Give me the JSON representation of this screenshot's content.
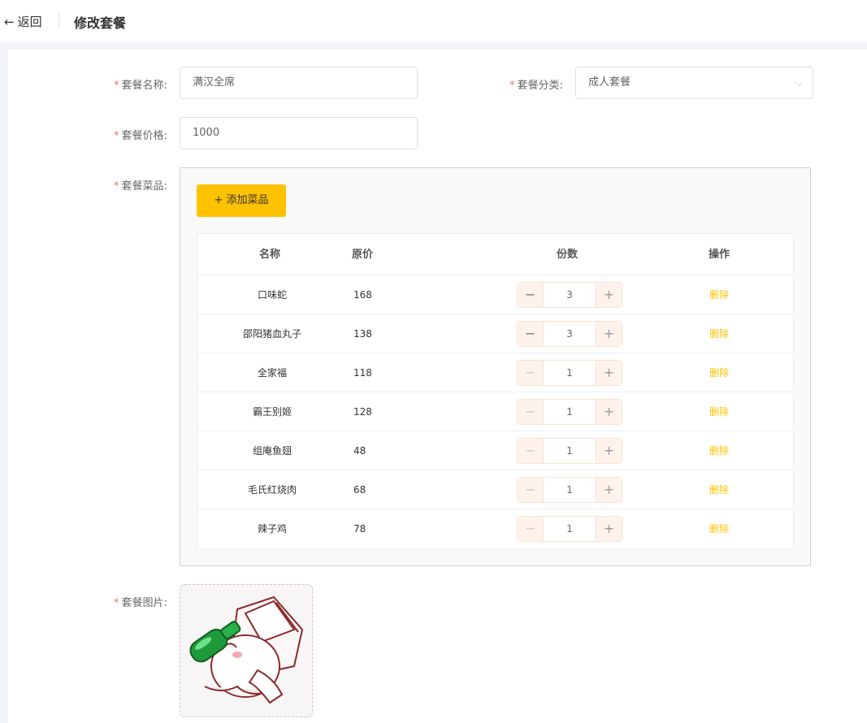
{
  "header": {
    "back_label": "返回",
    "title": "修改套餐"
  },
  "form": {
    "star": "*",
    "name_label": "套餐名称:",
    "name_value": "满汉全席",
    "category_label": "套餐分类:",
    "category_value": "成人套餐",
    "price_label": "套餐价格:",
    "price_value": "1000",
    "dishes_label": "套餐菜品:",
    "image_label": "套餐图片:"
  },
  "dishes": {
    "add_button": "+ 添加菜品",
    "columns": [
      "名称",
      "原价",
      "份数",
      "操作"
    ],
    "rows": [
      {
        "name": "口味蛇",
        "price": "168",
        "qty": "3",
        "action": "删除"
      },
      {
        "name": "邵阳猪血丸子",
        "price": "138",
        "qty": "3",
        "action": "删除"
      },
      {
        "name": "全家福",
        "price": "118",
        "qty": "1",
        "action": "删除"
      },
      {
        "name": "霸王别姬",
        "price": "128",
        "qty": "1",
        "action": "删除"
      },
      {
        "name": "组庵鱼翅",
        "price": "48",
        "qty": "1",
        "action": "删除"
      },
      {
        "name": "毛氏红烧肉",
        "price": "68",
        "qty": "1",
        "action": "删除"
      },
      {
        "name": "辣子鸡",
        "price": "78",
        "qty": "1",
        "action": "删除"
      }
    ]
  },
  "colors": {
    "accent": "#ffc200",
    "required": "#f56c6c"
  }
}
